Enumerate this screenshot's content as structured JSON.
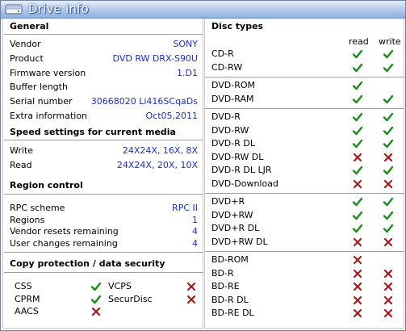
{
  "window": {
    "title": "Drive info"
  },
  "general": {
    "header": "General",
    "rows": [
      {
        "label": "Vendor",
        "value": "SONY"
      },
      {
        "label": "Product",
        "value": "DVD RW DRX-S90U"
      },
      {
        "label": "Firmware version",
        "value": "1.D1"
      },
      {
        "label": "Buffer length",
        "value": ""
      },
      {
        "label": "Serial number",
        "value": "30668020 Li416SCqaDs"
      },
      {
        "label": "Extra information",
        "value": "Oct05,2011"
      }
    ]
  },
  "speed": {
    "header": "Speed settings for current media",
    "rows": [
      {
        "label": "Write",
        "value": "24X24X, 16X, 8X"
      },
      {
        "label": "Read",
        "value": "24X24X, 20X, 10X"
      }
    ]
  },
  "region": {
    "header": "Region control",
    "rows": [
      {
        "label": "RPC scheme",
        "value": "RPC II"
      },
      {
        "label": "Regions",
        "value": "1"
      },
      {
        "label": "Vendor resets remaining",
        "value": "4"
      },
      {
        "label": "User changes remaining",
        "value": "4"
      }
    ]
  },
  "copy_protection": {
    "header": "Copy protection / data security",
    "items": [
      {
        "label": "CSS",
        "supported": true
      },
      {
        "label": "VCPS",
        "supported": false
      },
      {
        "label": "CPRM",
        "supported": true
      },
      {
        "label": "SecurDisc",
        "supported": false
      },
      {
        "label": "AACS",
        "supported": false
      }
    ]
  },
  "disc_types": {
    "header": "Disc types",
    "col_read": "read",
    "col_write": "write",
    "groups": [
      [
        {
          "label": "CD-R",
          "read": "yes",
          "write": "yes"
        },
        {
          "label": "CD-RW",
          "read": "yes",
          "write": "yes"
        }
      ],
      [
        {
          "label": "DVD-ROM",
          "read": "yes",
          "write": "none"
        },
        {
          "label": "DVD-RAM",
          "read": "yes",
          "write": "yes"
        }
      ],
      [
        {
          "label": "DVD-R",
          "read": "yes",
          "write": "yes"
        },
        {
          "label": "DVD-RW",
          "read": "yes",
          "write": "yes"
        },
        {
          "label": "DVD-R DL",
          "read": "yes",
          "write": "yes"
        },
        {
          "label": "DVD-RW DL",
          "read": "no",
          "write": "no"
        },
        {
          "label": "DVD-R DL LJR",
          "read": "yes",
          "write": "yes"
        },
        {
          "label": "DVD-Download",
          "read": "no",
          "write": "no"
        }
      ],
      [
        {
          "label": "DVD+R",
          "read": "yes",
          "write": "yes"
        },
        {
          "label": "DVD+RW",
          "read": "yes",
          "write": "yes"
        },
        {
          "label": "DVD+R DL",
          "read": "yes",
          "write": "yes"
        },
        {
          "label": "DVD+RW DL",
          "read": "no",
          "write": "no"
        }
      ],
      [
        {
          "label": "BD-ROM",
          "read": "no",
          "write": "none"
        },
        {
          "label": "BD-R",
          "read": "no",
          "write": "no"
        },
        {
          "label": "BD-RE",
          "read": "no",
          "write": "no"
        },
        {
          "label": "BD-R DL",
          "read": "no",
          "write": "no"
        },
        {
          "label": "BD-RE DL",
          "read": "no",
          "write": "no"
        }
      ]
    ]
  },
  "colors": {
    "value_blue": "#1f2fbf",
    "check_green": "#1d8a1d",
    "cross_red": "#a51b1b",
    "title_bar": "#8fb0e0"
  },
  "icons": {
    "title": "drive-icon",
    "yes": "check-icon",
    "no": "cross-icon"
  }
}
